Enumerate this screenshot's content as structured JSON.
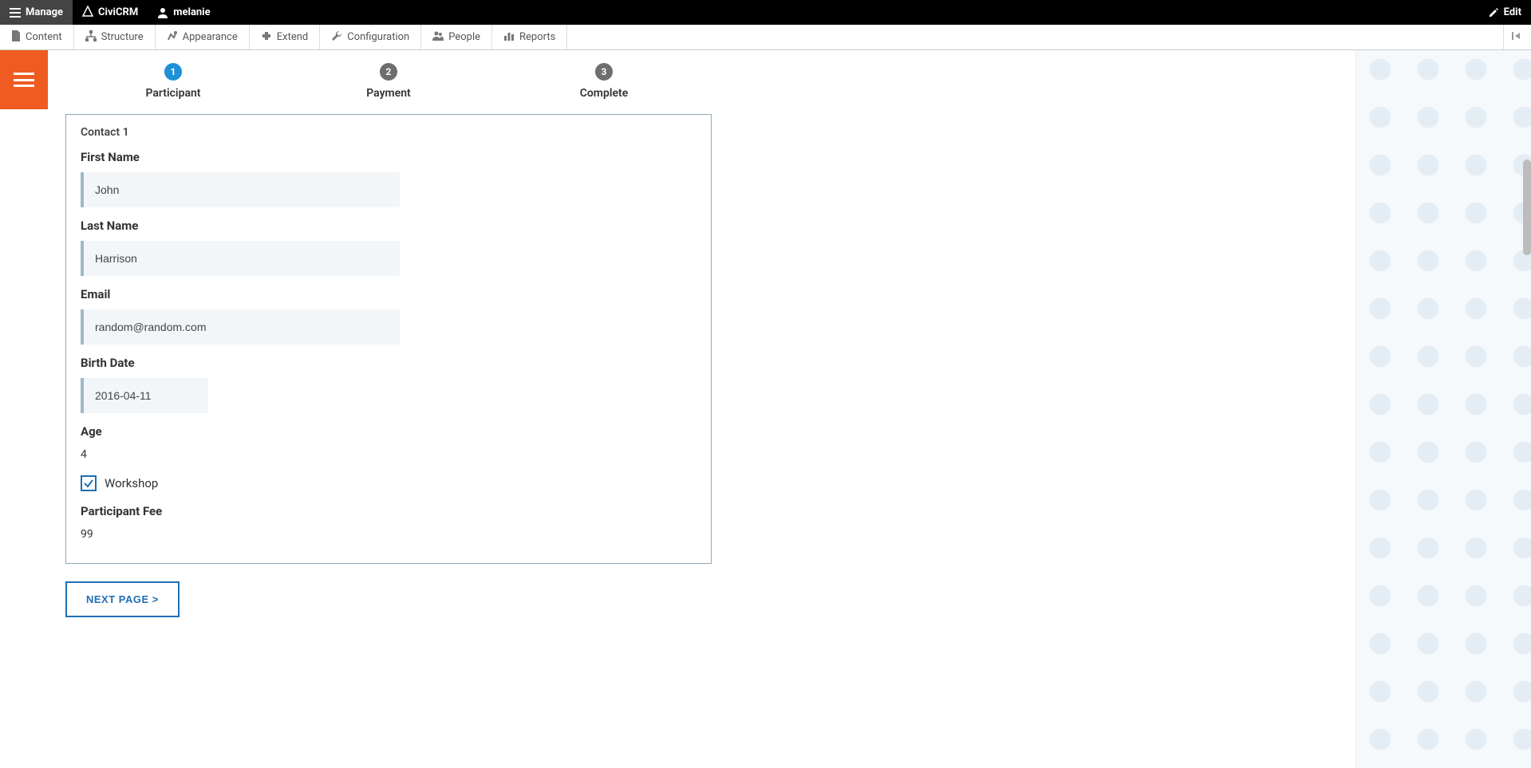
{
  "toolbar_top": {
    "manage_label": "Manage",
    "civicrm_label": "CiviCRM",
    "username": "melanie",
    "edit_label": "Edit"
  },
  "toolbar_sub": {
    "items": [
      {
        "label": "Content"
      },
      {
        "label": "Structure"
      },
      {
        "label": "Appearance"
      },
      {
        "label": "Extend"
      },
      {
        "label": "Configuration"
      },
      {
        "label": "People"
      },
      {
        "label": "Reports"
      }
    ]
  },
  "progress": {
    "steps": [
      {
        "num": "1",
        "label": "Participant",
        "current": true
      },
      {
        "num": "2",
        "label": "Payment",
        "current": false
      },
      {
        "num": "3",
        "label": "Complete",
        "current": false
      }
    ]
  },
  "fieldset": {
    "legend": "Contact 1",
    "first_name_label": "First Name",
    "first_name_value": "John",
    "last_name_label": "Last Name",
    "last_name_value": "Harrison",
    "email_label": "Email",
    "email_value": "random@random.com",
    "birth_date_label": "Birth Date",
    "birth_date_value": "2016-04-11",
    "age_label": "Age",
    "age_value": "4",
    "workshop_checked": true,
    "workshop_label": "Workshop",
    "participant_fee_label": "Participant Fee",
    "participant_fee_value": "99"
  },
  "next_button_label": "NEXT PAGE >"
}
